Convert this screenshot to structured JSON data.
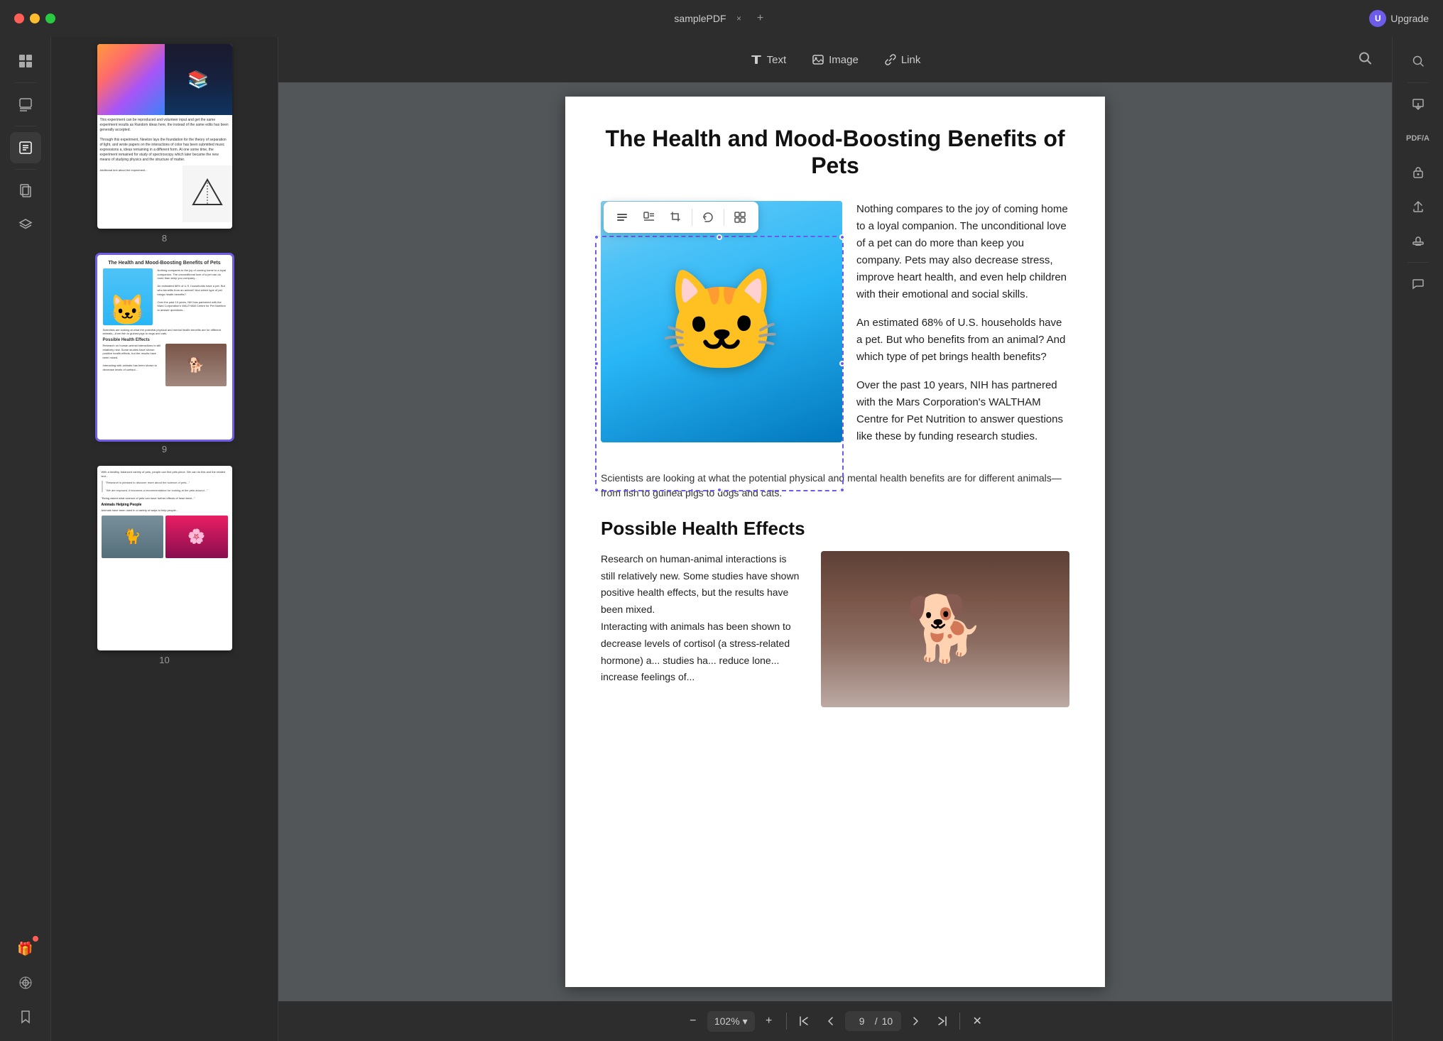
{
  "titlebar": {
    "tab_name": "samplePDF",
    "close_label": "×",
    "add_tab_label": "+",
    "upgrade_label": "Upgrade",
    "user_initial": "U"
  },
  "toolbar": {
    "text_label": "Text",
    "image_label": "Image",
    "link_label": "Link"
  },
  "image_toolbar": {
    "tools": [
      "⊞",
      "⊡",
      "⊠",
      "⊟",
      "⊕"
    ]
  },
  "pdf_page": {
    "title": "The Health and Mood-Boosting Benefits of Pets",
    "intro_text1": "Nothing compares to the joy of coming home to a loyal companion. The unconditional love of a pet can do more than keep you company. Pets may also decrease stress, improve heart health,  and  even  help children  with  their emotional and social skills.",
    "intro_text2": "An estimated 68% of U.S. households have a pet. But who benefits from an animal? And which type of pet brings health benefits?",
    "intro_text3": "Over  the  past  10  years,  NIH  has partnered with the Mars Corporation's WALTHAM Centre for  Pet  Nutrition  to answer  questions  like these by funding research studies.",
    "caption": "Scientists are looking at what the potential physical and mental health benefits are for different animals—from fish to guinea pigs to dogs and cats.",
    "section_title": "Possible Health Effects",
    "body_text1": "Research  on  human-animal  interactions is still  relatively  new.  Some  studies  have shown  positive  health  effects,  but  the results have been mixed.",
    "body_text2": "Interacting with animals has been shown to decrease levels of cortisol (a stress-related hormone) a... studies ha... reduce lone... increase feelings of..."
  },
  "page_navigation": {
    "zoom_value": "102%",
    "current_page": "9",
    "total_pages": "10",
    "zoom_in": "+",
    "zoom_out": "−"
  },
  "thumbnails": [
    {
      "number": "8"
    },
    {
      "number": "9",
      "selected": true
    },
    {
      "number": "10"
    }
  ],
  "sidebar_icons": {
    "thumbnail": "▦",
    "edit": "✎",
    "annotate": "✏",
    "pages": "⊞",
    "layers": "◈",
    "bookmark": "🔖",
    "gift": "🎁"
  },
  "right_sidebar_icons": {
    "search": "🔍",
    "import": "⬇",
    "pdf_a": "A",
    "secure": "🔒",
    "share": "↑",
    "stamp": "✓",
    "chat": "💬"
  }
}
